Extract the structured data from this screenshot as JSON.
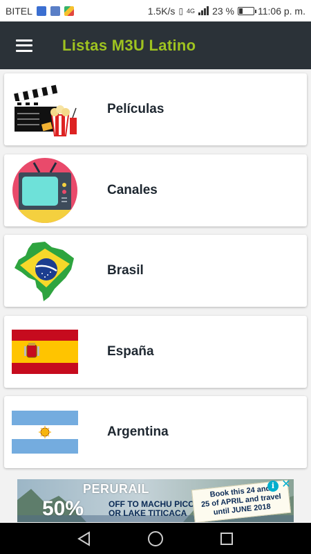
{
  "status_bar": {
    "carrier": "BITEL",
    "network_speed": "1.5K/s",
    "network_type": "4G",
    "battery_percent": "23 %",
    "time": "11:06 p. m."
  },
  "app_bar": {
    "title": "Listas M3U Latino",
    "menu_icon": "hamburger-menu-icon",
    "background": "#2b3238",
    "title_color": "#9fc320"
  },
  "categories": [
    {
      "label": "Películas",
      "icon": "clapperboard-popcorn-icon"
    },
    {
      "label": "Canales",
      "icon": "tv-icon"
    },
    {
      "label": "Brasil",
      "icon": "brazil-map-flag-icon"
    },
    {
      "label": "España",
      "icon": "spain-flag-icon"
    },
    {
      "label": "Argentina",
      "icon": "argentina-flag-icon"
    }
  ],
  "ad": {
    "brand": "PERURAIL",
    "discount": "50%",
    "offer_line1": "OFF TO MACHU PICCHU",
    "offer_line2": "OR LAKE TITICACA",
    "promo_line1": "Book this 24 and",
    "promo_line2": "25 of APRIL and travel",
    "promo_line3": "until JUNE 2018",
    "info_icon": "i",
    "close_icon": "✕"
  },
  "nav_bar": {
    "back_icon": "back-triangle-icon",
    "home_icon": "home-circle-icon",
    "recents_icon": "recents-square-icon"
  }
}
